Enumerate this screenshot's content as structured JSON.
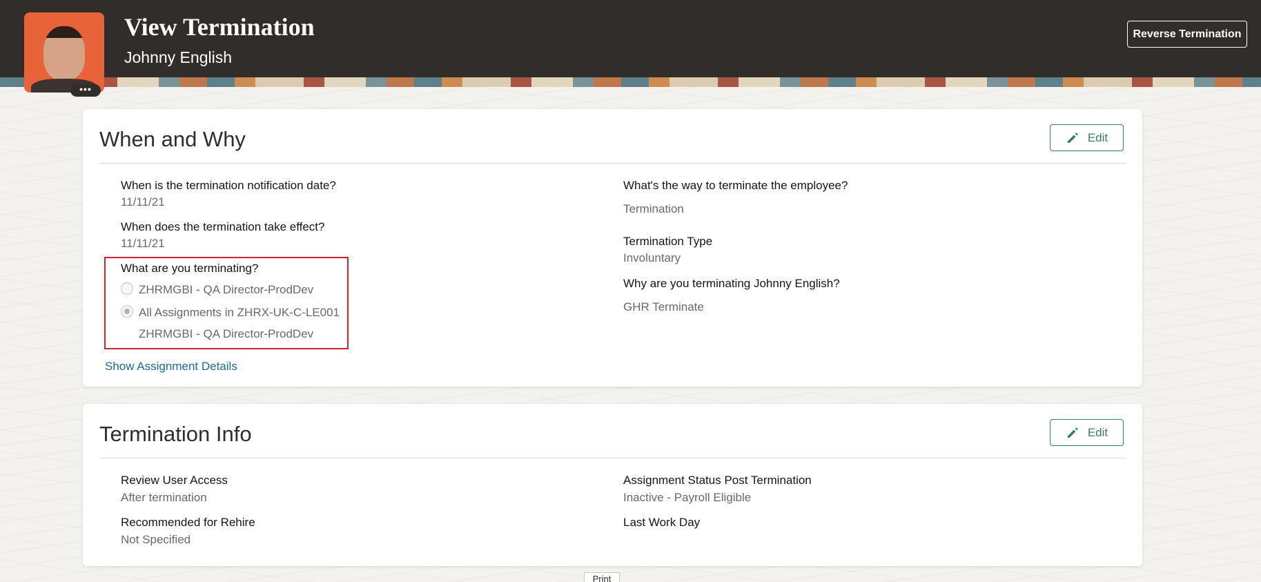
{
  "header": {
    "title": "View Termination",
    "subtitle": "Johnny English",
    "reverse_button": "Reverse Termination",
    "avatar_more": "•••"
  },
  "when_why": {
    "title": "When and Why",
    "edit_label": "Edit",
    "notification_label": "When is the termination notification date?",
    "notification_value": "11/11/21",
    "effective_label": "When does the termination take effect?",
    "effective_value": "11/11/21",
    "terminating_label": "What are you terminating?",
    "options": [
      {
        "label": "ZHRMGBI - QA Director-ProdDev",
        "selected": false
      },
      {
        "label": "All Assignments in ZHRX-UK-C-LE001",
        "selected": true
      }
    ],
    "option_sub": "ZHRMGBI - QA Director-ProdDev",
    "show_details_link": "Show Assignment Details",
    "way_label": "What's the way to terminate the employee?",
    "way_value": "Termination",
    "type_label": "Termination Type",
    "type_value": "Involuntary",
    "why_label": "Why are you terminating Johnny English?",
    "why_value": "GHR Terminate"
  },
  "termination_info": {
    "title": "Termination Info",
    "edit_label": "Edit",
    "user_access_label": "Review User Access",
    "user_access_value": "After termination",
    "rehire_label": "Recommended for Rehire",
    "rehire_value": "Not Specified",
    "status_label": "Assignment Status Post Termination",
    "status_value": "Inactive - Payroll Eligible",
    "last_day_label": "Last Work Day"
  },
  "footer": {
    "print_label": "Print"
  },
  "colors": {
    "header_bg": "#312d2a",
    "accent_green": "#3b7b65",
    "link_blue": "#1a6a8c",
    "highlight_red": "#d0222c"
  }
}
